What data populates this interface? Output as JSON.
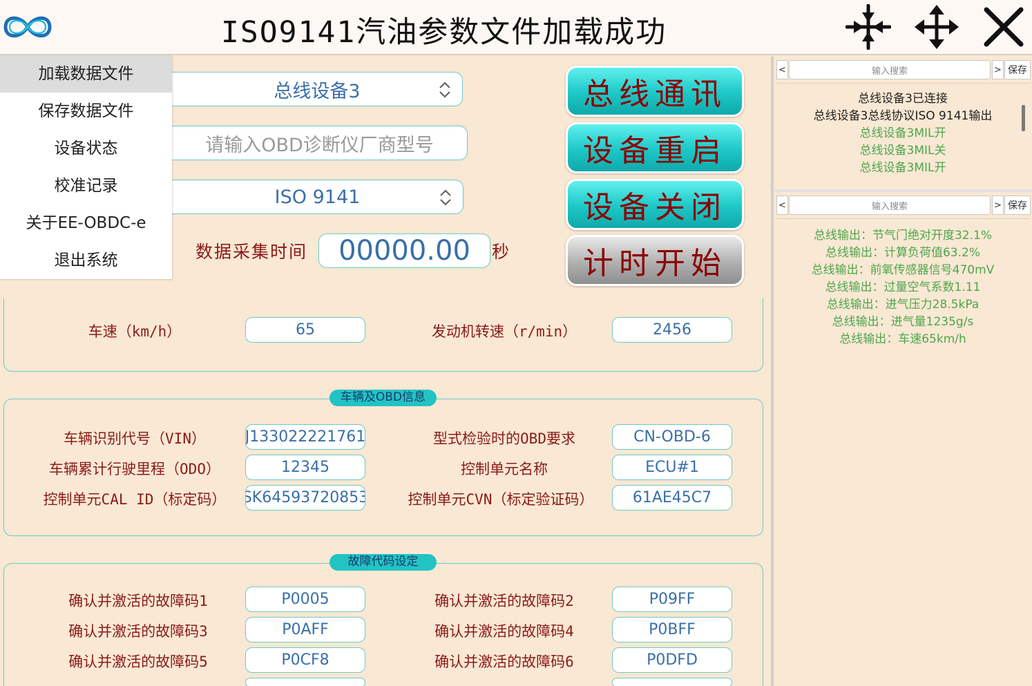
{
  "titlebar": {
    "title": "ISO9141汽油参数文件加载成功",
    "icons": [
      "infinity-logo-icon",
      "shrink-arrows-icon",
      "move-arrows-icon",
      "close-icon"
    ]
  },
  "menu": {
    "items": [
      {
        "label": "加载数据文件",
        "active": true
      },
      {
        "label": "保存数据文件"
      },
      {
        "label": "设备状态"
      },
      {
        "label": "校准记录"
      },
      {
        "label": "关于EE-OBDC-e"
      },
      {
        "label": "退出系统"
      }
    ]
  },
  "controls": {
    "device_select": "总线设备3",
    "obd_placeholder": "请输入OBD诊断仪厂商型号",
    "protocol_select": "ISO 9141",
    "time_label": "数据采集时间",
    "time_value": "00000.00",
    "time_unit": "秒"
  },
  "buttons": {
    "bus_comm": "总线通讯",
    "restart": "设备重启",
    "shutdown": "设备关闭",
    "timer_start": "计时开始"
  },
  "speed_group": {
    "speed_label": "车速（km/h）",
    "speed_value": "65",
    "rpm_label": "发动机转速（r/min）",
    "rpm_value": "2456"
  },
  "vehicle_group": {
    "title": "车辆及OBD信息",
    "rows": [
      {
        "left_label": "车辆识别代号（VIN）",
        "left_value": "J133022221761",
        "right_label": "型式检验时的OBD要求",
        "right_value": "CN-OBD-6"
      },
      {
        "left_label": "车辆累计行驶里程（ODO）",
        "left_value": "12345",
        "right_label": "控制单元名称",
        "right_value": "ECU#1"
      },
      {
        "left_label": "控制单元CAL ID（标定码）",
        "left_value": "SK64593720853",
        "right_label": "控制单元CVN（标定验证码）",
        "right_value": "61AE45C7"
      }
    ]
  },
  "dtc_group": {
    "title": "故障代码设定",
    "rows": [
      {
        "left_label": "确认并激活的故障码1",
        "left_value": "P0005",
        "right_label": "确认并激活的故障码2",
        "right_value": "P09FF"
      },
      {
        "left_label": "确认并激活的故障码3",
        "left_value": "P0AFF",
        "right_label": "确认并激活的故障码4",
        "right_value": "P0BFF"
      },
      {
        "left_label": "确认并激活的故障码5",
        "left_value": "P0CF8",
        "right_label": "确认并激活的故障码6",
        "right_value": "P0DFD"
      }
    ]
  },
  "log_panel_1": {
    "prev": "<",
    "next": ">",
    "search_placeholder": "输入搜索",
    "save": "保存",
    "lines": [
      {
        "text": "总线设备3已连接",
        "color": "black"
      },
      {
        "text": "总线设备3总线协议ISO 9141输出",
        "color": "black"
      },
      {
        "text": "总线设备3MIL开",
        "color": "green"
      },
      {
        "text": "总线设备3MIL关",
        "color": "green"
      },
      {
        "text": "总线设备3MIL开",
        "color": "green"
      }
    ]
  },
  "log_panel_2": {
    "prev": "<",
    "next": ">",
    "search_placeholder": "输入搜索",
    "save": "保存",
    "lines": [
      {
        "text": "总线输出：节气门绝对开度32.1%",
        "color": "green"
      },
      {
        "text": "总线输出：计算负荷值63.2%",
        "color": "green"
      },
      {
        "text": "总线输出：前氧传感器信号470mV",
        "color": "green"
      },
      {
        "text": "总线输出：过量空气系数1.11",
        "color": "green"
      },
      {
        "text": "总线输出：进气压力28.5kPa",
        "color": "green"
      },
      {
        "text": "总线输出：进气量1235g/s",
        "color": "green"
      },
      {
        "text": "总线输出：车速65km/h",
        "color": "green"
      }
    ]
  },
  "colors": {
    "background": "#f9e8d3",
    "accent_cyan": "#22c3c3",
    "label_red": "#8b1a1a",
    "value_blue": "#3a6fa8",
    "log_green": "#4ea64e"
  }
}
